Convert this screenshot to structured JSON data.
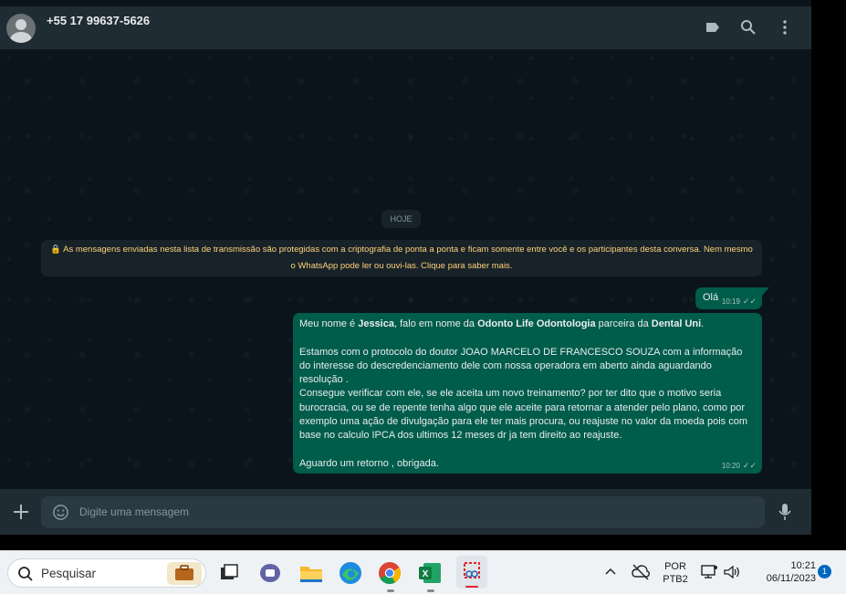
{
  "header": {
    "contact_name": "+55 17 99637-5626",
    "icons": [
      "label-icon",
      "search-icon",
      "menu-icon"
    ]
  },
  "chat": {
    "date_pill": "HOJE",
    "encryption_notice": "🔒 As mensagens enviadas nesta lista de transmissão são protegidas com a criptografia de ponta a ponta e ficam somente entre você e os participantes desta conversa. Nem mesmo o WhatsApp pode ler ou ouvi-las. Clique para saber mais.",
    "messages": [
      {
        "text": "Olá",
        "time": "10:19"
      },
      {
        "intro_prefix": "Meu nome é ",
        "name": "Jessica",
        "intro_mid": ", falo em nome da ",
        "company": "Odonto Life Odontologia",
        "intro_mid2": " parceira da ",
        "partner": "Dental Uni",
        "intro_end": ".",
        "paragraph2": "Estamos com o protocolo do doutor JOAO MARCELO DE FRANCESCO SOUZA com a informação do interesse do descredenciamento dele  com nossa operadora em aberto ainda aguardando resolução .",
        "paragraph3": "Consegue verificar com ele, se ele aceita um novo treinamento? por ter dito que o motivo seria burocracia, ou se de repente tenha algo que ele aceite para retornar a atender pelo plano, como por exemplo uma ação de divulgação para ele ter mais procura, ou reajuste no valor da moeda pois com base no calculo IPCA dos ultimos 12 meses dr ja tem direito ao reajuste.",
        "paragraph4": "Aguardo um retorno , obrigada.",
        "time": "10:20"
      }
    ]
  },
  "composer": {
    "placeholder": "Digite uma mensagem"
  },
  "taskbar": {
    "search_label": "Pesquisar",
    "language_line1": "POR",
    "language_line2": "PTB2",
    "time": "10:21",
    "date": "06/11/2023",
    "notification_count": "1"
  },
  "colors": {
    "outgoing_bubble": "#005c4b",
    "header_bg": "#202c33",
    "chat_bg": "#0b141a",
    "notice_text": "#ffd279"
  }
}
